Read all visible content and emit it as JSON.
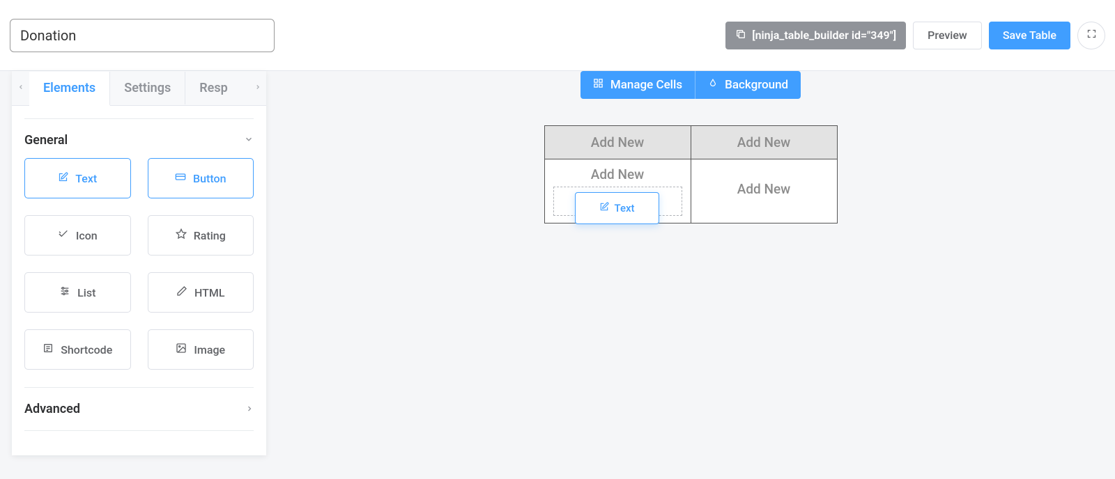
{
  "header": {
    "title_value": "Donation",
    "shortcode_label": "[ninja_table_builder id=\"349\"]",
    "preview_label": "Preview",
    "save_label": "Save Table"
  },
  "tabs": {
    "elements": "Elements",
    "settings": "Settings",
    "resp": "Resp"
  },
  "sidebar": {
    "general_label": "General",
    "advanced_label": "Advanced",
    "elements": {
      "text": "Text",
      "button": "Button",
      "icon": "Icon",
      "rating": "Rating",
      "list": "List",
      "html": "HTML",
      "shortcode": "Shortcode",
      "image": "Image"
    }
  },
  "toolbar": {
    "manage_cells": "Manage Cells",
    "background": "Background"
  },
  "table": {
    "header": [
      "Add New",
      "Add New"
    ],
    "cells": {
      "r1c1_placeholder": "Add New",
      "r1c1_ghost": "Text",
      "r1c1_drag": "Text",
      "r1c2_placeholder": "Add New"
    }
  }
}
